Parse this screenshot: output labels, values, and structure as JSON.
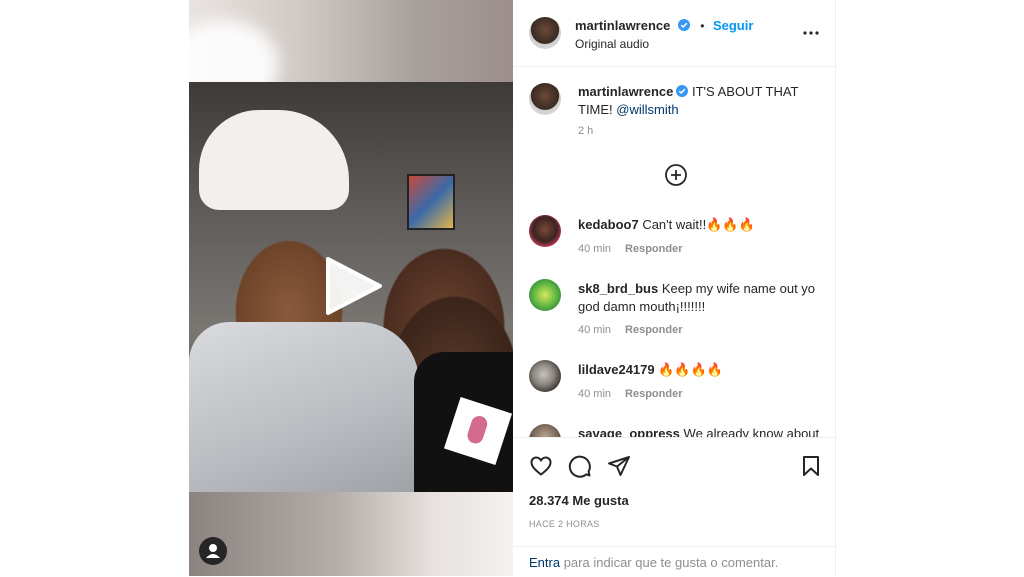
{
  "post": {
    "author": "martinlawrence",
    "follow_label": "Seguir",
    "audio_label": "Original audio",
    "separator": "•"
  },
  "caption": {
    "username": "martinlawrence",
    "text": "IT'S ABOUT THAT TIME!",
    "mention": "@willsmith",
    "time": "2 h"
  },
  "comments": [
    {
      "username": "kedaboo7",
      "text": "Can't wait!!🔥🔥🔥",
      "time": "40 min",
      "reply": "Responder"
    },
    {
      "username": "sk8_brd_bus",
      "text": "Keep my wife name out yo god damn mouth¡!!!!!!!",
      "time": "40 min",
      "reply": "Responder"
    },
    {
      "username": "lildave24179",
      "text": "🔥🔥🔥🔥",
      "time": "40 min",
      "reply": "Responder"
    },
    {
      "username": "savage_oppress",
      "text": "We already know about"
    }
  ],
  "engagement": {
    "likes": "28.374 Me gusta",
    "posted": "HACE 2 HORAS"
  },
  "login": {
    "link": "Entra",
    "text": "para indicar que te gusta o comentar."
  },
  "icons": {
    "verified": "verified-badge-icon",
    "more": "more-options-icon",
    "load_more": "add-circle-icon",
    "like": "heart-icon",
    "comment": "comment-icon",
    "share": "paper-plane-icon",
    "save": "bookmark-icon",
    "play": "play-icon",
    "tags": "user-tag-icon"
  },
  "colors": {
    "accent": "#0095f6",
    "verified": "#3897f0",
    "link": "#00376b",
    "muted": "#8e8e8e"
  }
}
